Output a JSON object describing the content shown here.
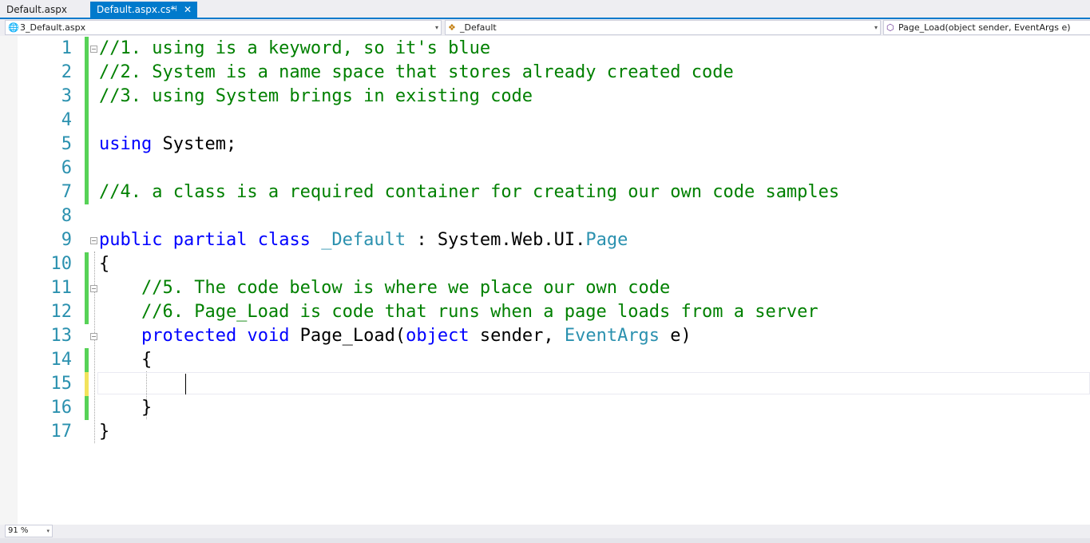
{
  "tabs": [
    {
      "label": "Default.aspx",
      "active": false
    },
    {
      "label": "Default.aspx.cs*",
      "active": true
    }
  ],
  "tab_icons": {
    "pin": "pin-icon",
    "close": "close-icon"
  },
  "nav": {
    "project": "3_Default.aspx",
    "class": "_Default",
    "member": "Page_Load(object sender, EventArgs e)"
  },
  "colors": {
    "accent": "#007ACC",
    "keyword": "#0000FF",
    "comment": "#008000",
    "type": "#2B91AF",
    "line_number": "#2B91AF",
    "saved_change": "#57D257",
    "unsaved_change": "#F2E35C"
  },
  "editor": {
    "lines": [
      {
        "n": "1",
        "t": "//1. using is a keyword, so it's blue"
      },
      {
        "n": "2",
        "t": "//2. System is a name space that stores already created code"
      },
      {
        "n": "3",
        "t": "//3. using System brings in existing code"
      },
      {
        "n": "4",
        "t": ""
      },
      {
        "n": "5",
        "t": "using System;"
      },
      {
        "n": "6",
        "t": ""
      },
      {
        "n": "7",
        "t": "//4. a class is a required container for creating our own code samples"
      },
      {
        "n": "8",
        "t": ""
      },
      {
        "n": "9",
        "t": "public partial class _Default : System.Web.UI.Page"
      },
      {
        "n": "10",
        "t": "{"
      },
      {
        "n": "11",
        "t": "    //5. The code below is where we place our own code"
      },
      {
        "n": "12",
        "t": "    //6. Page_Load is code that runs when a page loads from a server"
      },
      {
        "n": "13",
        "t": "    protected void Page_Load(object sender, EventArgs e)"
      },
      {
        "n": "14",
        "t": "    {"
      },
      {
        "n": "15",
        "t": "        "
      },
      {
        "n": "16",
        "t": "    }"
      },
      {
        "n": "17",
        "t": "}"
      }
    ],
    "tokens": {
      "l5": [
        "using",
        " System;"
      ],
      "l9": [
        "public",
        " ",
        "partial",
        " ",
        "class",
        " ",
        "_Default",
        " : System.Web.UI.",
        "Page"
      ],
      "l13": [
        "protected",
        " ",
        "void",
        " Page_Load(",
        "object",
        " sender, ",
        "EventArgs",
        " e)"
      ]
    }
  },
  "zoom": "91 %"
}
